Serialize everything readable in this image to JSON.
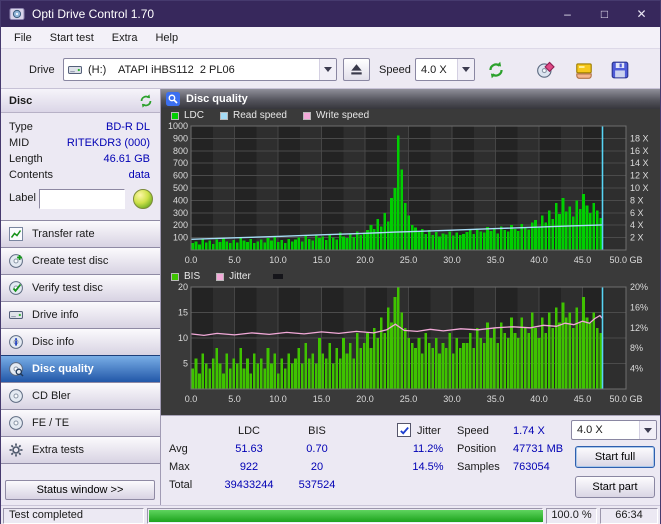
{
  "window": {
    "title": "Opti Drive Control 1.70",
    "controls": {
      "minimize": "–",
      "maximize": "□",
      "close": "✕"
    }
  },
  "menu": {
    "items": [
      "File",
      "Start test",
      "Extra",
      "Help"
    ]
  },
  "toolbar": {
    "drive_label": "Drive",
    "drive_value": "(H:)    ATAPI iHBS112  2 PL06",
    "speed_label": "Speed",
    "speed_value": "4.0 X",
    "icons": [
      "eject-icon",
      "speed-test-icon",
      "disc-tool-icon",
      "hand-card-icon",
      "save-icon"
    ]
  },
  "sidebar": {
    "disc_header": "Disc",
    "info": [
      {
        "label": "Type",
        "value": "BD-R DL"
      },
      {
        "label": "MID",
        "value": "RITEKDR3 (000)"
      },
      {
        "label": "Length",
        "value": "46.61 GB"
      },
      {
        "label": "Contents",
        "value": "data"
      }
    ],
    "label_row": {
      "label": "Label",
      "value": ""
    },
    "buttons": [
      "Transfer rate",
      "Create test disc",
      "Verify test disc",
      "Drive info",
      "Disc info",
      "Disc quality",
      "CD Bler",
      "FE / TE",
      "Extra tests"
    ],
    "selected_button": "Disc quality",
    "status_window_label": "Status window >>"
  },
  "panel": {
    "title": "Disc quality"
  },
  "legend_top": [
    {
      "label": "LDC",
      "color": "#00cf00"
    },
    {
      "label": "Read speed",
      "color": "#a6dcf5"
    },
    {
      "label": "Write speed",
      "color": "#f2a9d8"
    }
  ],
  "legend_bottom": [
    {
      "label": "BIS",
      "color": "#3fc300"
    },
    {
      "label": "Jitter",
      "color": "#f2a9d8"
    }
  ],
  "stats": {
    "col_headers": [
      "LDC",
      "BIS"
    ],
    "rows": [
      {
        "label": "Avg",
        "ldc": "51.63",
        "bis": "0.70",
        "jitter": "11.2%"
      },
      {
        "label": "Max",
        "ldc": "922",
        "bis": "20",
        "jitter": "14.5%"
      },
      {
        "label": "Total",
        "ldc": "39433244",
        "bis": "537524",
        "jitter": ""
      }
    ],
    "jitter_label": "Jitter",
    "jitter_checked": true,
    "speed_label": "Speed",
    "speed_value": "1.74 X",
    "position_label": "Position",
    "position_value": "47731 MB",
    "samples_label": "Samples",
    "samples_value": "763054",
    "speed_select": "4.0 X",
    "start_full_label": "Start full",
    "start_part_label": "Start part"
  },
  "statusbar": {
    "status": "Test completed",
    "progress_pct": 100,
    "progress_text": "100.0 %",
    "time": "66:34"
  },
  "colors": {
    "titlebar": "#37285c",
    "selected_item": "#2257a8",
    "chart_bg": "#262626",
    "value_text": "#0000b4",
    "progress_green": "#2db52d"
  },
  "chart_data": [
    {
      "type": "bar",
      "name": "ldc-read-speed-chart",
      "title": "Disc quality - LDC with read speed overlay",
      "x_unit": "GB",
      "x_max": 50,
      "data_end": 47.3,
      "stripe_w": 2.5,
      "x_ticks": [
        {
          "v": 0,
          "label": "0.0"
        },
        {
          "v": 5,
          "label": "5.0"
        },
        {
          "v": 10,
          "label": "10.0"
        },
        {
          "v": 15,
          "label": "15.0"
        },
        {
          "v": 20,
          "label": "20.0"
        },
        {
          "v": 25,
          "label": "25.0"
        },
        {
          "v": 30,
          "label": "30.0"
        },
        {
          "v": 35,
          "label": "35.0"
        },
        {
          "v": 40,
          "label": "40.0"
        },
        {
          "v": 45,
          "label": "45.0"
        },
        {
          "v": 50,
          "label": "50.0 GB"
        }
      ],
      "y_left_max": 1000,
      "left_ticks": [
        {
          "v": 1000,
          "label": "1000"
        },
        {
          "v": 900,
          "label": "900"
        },
        {
          "v": 800,
          "label": "800"
        },
        {
          "v": 700,
          "label": "700"
        },
        {
          "v": 600,
          "label": "600"
        },
        {
          "v": 500,
          "label": "500"
        },
        {
          "v": 400,
          "label": "400"
        },
        {
          "v": 300,
          "label": "300"
        },
        {
          "v": 200,
          "label": "200"
        },
        {
          "v": 100,
          "label": "100"
        }
      ],
      "y_right_max": 20,
      "right_ticks": [
        {
          "v": 18,
          "label": "18 X"
        },
        {
          "v": 16,
          "label": "16 X"
        },
        {
          "v": 14,
          "label": "14 X"
        },
        {
          "v": 12,
          "label": "12 X"
        },
        {
          "v": 10,
          "label": "10 X"
        },
        {
          "v": 8,
          "label": "8 X"
        },
        {
          "v": 6,
          "label": "6 X"
        },
        {
          "v": 4,
          "label": "4 X"
        },
        {
          "v": 2,
          "label": "2 X"
        }
      ],
      "bar_color": "#00cf00",
      "bars": [
        55,
        70,
        45,
        90,
        60,
        75,
        50,
        85,
        65,
        95,
        70,
        55,
        80,
        60,
        100,
        75,
        65,
        90,
        55,
        70,
        85,
        60,
        95,
        75,
        110,
        65,
        80,
        55,
        90,
        70,
        85,
        100,
        70,
        115,
        90,
        75,
        120,
        95,
        110,
        80,
        130,
        100,
        85,
        140,
        110,
        95,
        125,
        105,
        150,
        120,
        140,
        160,
        200,
        170,
        250,
        190,
        300,
        230,
        420,
        500,
        922,
        650,
        380,
        280,
        200,
        180,
        150,
        170,
        130,
        160,
        120,
        145,
        110,
        135,
        125,
        150,
        115,
        140,
        120,
        130,
        145,
        160,
        130,
        175,
        150,
        140,
        185,
        155,
        170,
        135,
        190,
        160,
        150,
        200,
        170,
        155,
        210,
        180,
        165,
        220,
        240,
        190,
        280,
        220,
        320,
        250,
        380,
        290,
        420,
        310,
        350,
        270,
        400,
        330,
        450,
        360,
        300,
        380,
        320,
        260
      ],
      "lines": [
        {
          "name": "read-speed",
          "color": "#a6dcf5",
          "width": 1.4,
          "axis": "right",
          "points": [
            [
              0,
              1.72
            ],
            [
              5,
              1.96
            ],
            [
              10,
              2.2
            ],
            [
              15,
              2.45
            ],
            [
              20,
              2.7
            ],
            [
              23.5,
              2.88
            ],
            [
              25,
              2.95
            ],
            [
              30,
              3.2
            ],
            [
              35,
              3.45
            ],
            [
              40,
              3.7
            ],
            [
              44,
              3.9
            ],
            [
              47.3,
              4.05
            ]
          ]
        }
      ],
      "marker": {
        "x": 47.3,
        "color": "#58d4f4"
      }
    },
    {
      "type": "bar",
      "name": "bis-jitter-chart",
      "title": "Disc quality - BIS with jitter overlay",
      "x_unit": "GB",
      "x_max": 50,
      "data_end": 47.3,
      "stripe_w": 2.5,
      "x_ticks": [
        {
          "v": 0,
          "label": "0.0"
        },
        {
          "v": 5,
          "label": "5.0"
        },
        {
          "v": 10,
          "label": "10.0"
        },
        {
          "v": 15,
          "label": "15.0"
        },
        {
          "v": 20,
          "label": "20.0"
        },
        {
          "v": 25,
          "label": "25.0"
        },
        {
          "v": 30,
          "label": "30.0"
        },
        {
          "v": 35,
          "label": "35.0"
        },
        {
          "v": 40,
          "label": "40.0"
        },
        {
          "v": 45,
          "label": "45.0"
        },
        {
          "v": 50,
          "label": "50.0 GB"
        }
      ],
      "y_left_max": 20,
      "left_ticks": [
        {
          "v": 20,
          "label": "20"
        },
        {
          "v": 15,
          "label": "15"
        },
        {
          "v": 10,
          "label": "10"
        },
        {
          "v": 5,
          "label": "5"
        }
      ],
      "y_right_max": 20,
      "right_ticks": [
        {
          "v": 20,
          "label": "20%"
        },
        {
          "v": 16,
          "label": "16%"
        },
        {
          "v": 12,
          "label": "12%"
        },
        {
          "v": 8,
          "label": "8%"
        },
        {
          "v": 4,
          "label": "4%"
        }
      ],
      "bar_color": "#3fc300",
      "bars": [
        4,
        6,
        3,
        7,
        5,
        4,
        6,
        8,
        5,
        3,
        7,
        4,
        6,
        5,
        8,
        4,
        6,
        3,
        7,
        5,
        6,
        4,
        8,
        5,
        7,
        3,
        6,
        4,
        7,
        5,
        6,
        8,
        5,
        9,
        6,
        7,
        5,
        10,
        7,
        6,
        9,
        5,
        8,
        6,
        10,
        7,
        9,
        6,
        11,
        8,
        9,
        11,
        8,
        12,
        10,
        14,
        11,
        16,
        13,
        18,
        20,
        15,
        12,
        10,
        9,
        8,
        10,
        7,
        11,
        9,
        8,
        10,
        7,
        9,
        8,
        11,
        7,
        10,
        8,
        9,
        9,
        11,
        8,
        12,
        10,
        9,
        13,
        10,
        12,
        9,
        13,
        11,
        10,
        14,
        11,
        10,
        14,
        12,
        11,
        15,
        12,
        10,
        14,
        11,
        15,
        12,
        16,
        13,
        17,
        14,
        15,
        12,
        16,
        13,
        18,
        14,
        13,
        15,
        12,
        11
      ],
      "lines": [
        {
          "name": "jitter",
          "color": "#f2a9d8",
          "width": 1.3,
          "axis": "right",
          "points": [
            [
              0,
              10.8
            ],
            [
              1.5,
              10.5
            ],
            [
              3,
              10.9
            ],
            [
              5,
              10.6
            ],
            [
              7,
              11.0
            ],
            [
              9,
              10.7
            ],
            [
              11,
              11.1
            ],
            [
              13,
              10.8
            ],
            [
              15,
              11.2
            ],
            [
              17,
              10.9
            ],
            [
              19,
              11.3
            ],
            [
              21,
              11.0
            ],
            [
              22.5,
              11.6
            ],
            [
              23.5,
              12.7
            ],
            [
              24.5,
              11.5
            ],
            [
              26,
              11.3
            ],
            [
              27.5,
              11.7
            ],
            [
              29,
              11.4
            ],
            [
              31,
              11.8
            ],
            [
              33,
              11.6
            ],
            [
              35,
              12.0
            ],
            [
              37,
              12.2
            ],
            [
              39,
              12.0
            ],
            [
              40.5,
              12.5
            ],
            [
              42,
              12.3
            ],
            [
              43,
              12.9
            ],
            [
              44,
              12.6
            ],
            [
              45,
              13.3
            ],
            [
              45.8,
              12.9
            ],
            [
              46.4,
              13.8
            ],
            [
              47,
              14.4
            ],
            [
              47.3,
              13.8
            ]
          ]
        }
      ],
      "marker": {
        "x": 47.3,
        "color": "#58d4f4"
      }
    }
  ]
}
